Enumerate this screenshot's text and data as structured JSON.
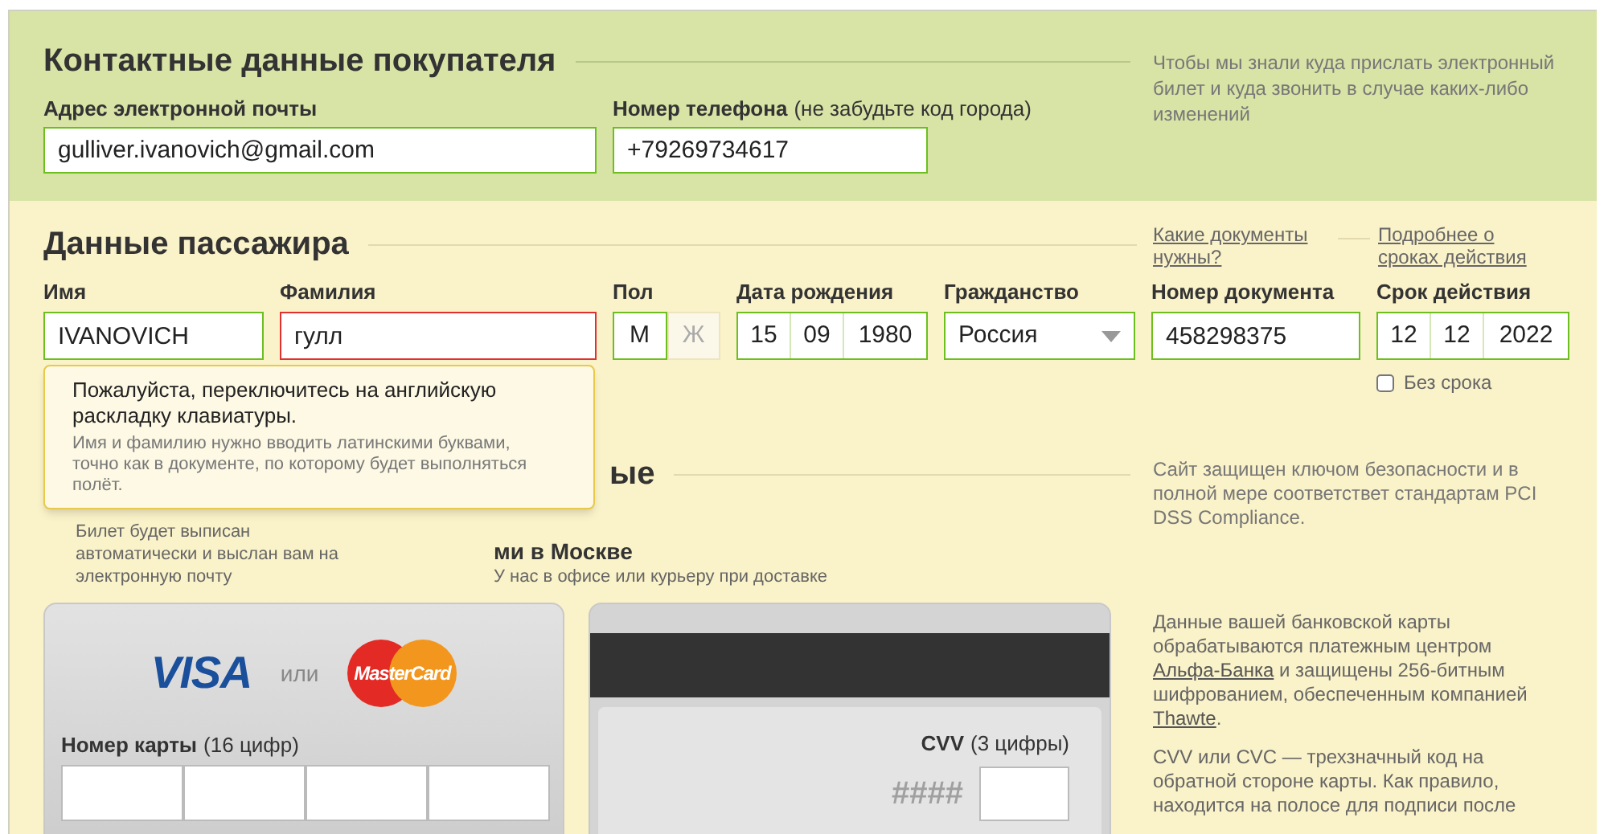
{
  "contact": {
    "title": "Контактные данные покупателя",
    "fields": [
      {
        "label": "Адрес электронной почты",
        "value": "gulliver.ivanovich@gmail.com",
        "valid": true
      },
      {
        "label": "Номер телефона",
        "label_note": "(не забудьте код города)",
        "value": "+79269734617",
        "valid": true
      }
    ],
    "side_note": "Чтобы мы знали куда прислать электронный билет и куда звонить в случае каких-либо изменений"
  },
  "passenger": {
    "title": "Данные пассажира",
    "links": [
      "Какие документы нужны?",
      "Подробнее о сроках действия"
    ],
    "fields": [
      {
        "kind": "text",
        "label": "Имя",
        "value": "IVANOVICH",
        "valid": true
      },
      {
        "kind": "text",
        "label": "Фамилия",
        "value": "гулл",
        "valid": false
      },
      {
        "kind": "choice",
        "label": "Пол",
        "options": [
          {
            "label": "М",
            "selected": true
          },
          {
            "label": "Ж",
            "selected": false
          }
        ]
      },
      {
        "kind": "parts",
        "label": "Дата рождения",
        "parts": [
          "15",
          "09",
          "1980"
        ],
        "valid": true
      },
      {
        "kind": "select",
        "label": "Гражданство",
        "value": "Россия",
        "valid": true
      },
      {
        "kind": "text",
        "label": "Номер документа",
        "value": "458298375",
        "valid": true
      },
      {
        "kind": "parts",
        "label": "Срок действия",
        "parts": [
          "12",
          "12",
          "2022"
        ],
        "valid": true,
        "checkbox": {
          "label": "Без срока",
          "checked": false
        }
      }
    ],
    "tooltip": {
      "title": "Пожалуйста, переключитесь на английскую раскладку клавиатуры.",
      "body": "Имя и фамилию нужно вводить латинскими буквами, точно как в документе, по которому будет выполняться полёт."
    }
  },
  "delivery": {
    "title": "ые",
    "options": [
      {
        "description": "Билет будет выписан автоматически и выслан вам на электронную почту"
      },
      {
        "title": "ми в Москве",
        "description": "У нас в офисе или курьеру при доставке"
      }
    ],
    "side_note": "Сайт защищен ключом безопасности и в полной мере соответствет стандартам PCI DSS Compliance."
  },
  "card": {
    "front": {
      "logos": [
        "VISA",
        "MasterCard"
      ],
      "or": "или",
      "number_label": "Номер карты",
      "number_hint": "(16 цифр)"
    },
    "back": {
      "cvv_label": "CVV",
      "cvv_hint": "(3 цифры)",
      "mask": "####"
    },
    "side_notes": [
      [
        {
          "text": "Данные вашей банковской карты обрабатываются платежным центром "
        },
        {
          "text": "Альфа-Банка",
          "link": true
        },
        {
          "text": " и защищены 256-битным шифрованием, обеспеченным компанией "
        },
        {
          "text": "Thawte",
          "link": true
        },
        {
          "text": "."
        }
      ],
      [
        {
          "text": "CVV или CVC — трехзначный код на обратной стороне карты. Как правило, находится на полосе для подписи после"
        }
      ]
    ]
  }
}
